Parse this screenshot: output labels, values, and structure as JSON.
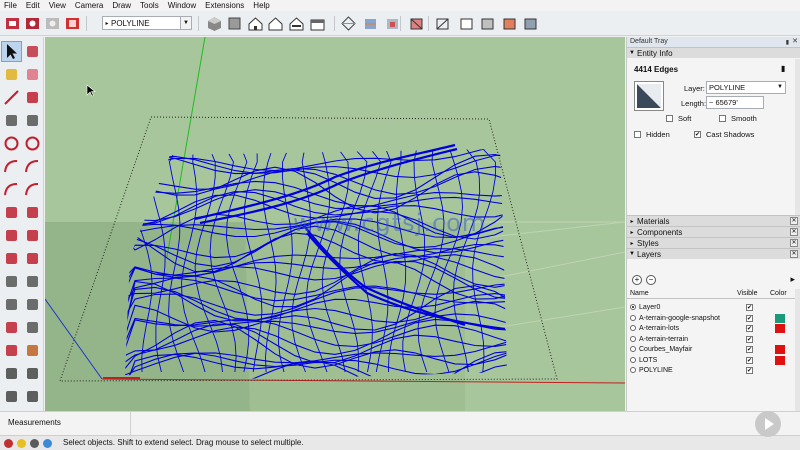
{
  "menu": [
    "File",
    "Edit",
    "View",
    "Camera",
    "Draw",
    "Tools",
    "Window",
    "Extensions",
    "Help"
  ],
  "toolbar": {
    "layer_select_value": "POLYLINE",
    "icons": [
      "get-models-icon",
      "share-model-icon",
      "share-component-icon",
      "extension-warehouse-icon",
      "iso-view-icon",
      "top-view-icon",
      "front-view-icon",
      "right-view-icon",
      "back-view-icon",
      "left-view-icon",
      "section-plane-icon",
      "display-section-icon",
      "section-cuts-icon",
      "xray-icon",
      "wireframe-icon",
      "hidden-line-icon",
      "shaded-icon",
      "shaded-textures-icon",
      "monochrome-icon"
    ]
  },
  "left_tools": [
    "select-tool-icon",
    "component-tool-icon",
    "paint-bucket-icon",
    "eraser-icon",
    "line-tool-icon",
    "freehand-tool-icon",
    "rectangle-tool-icon",
    "rotated-rectangle-icon",
    "circle-tool-icon",
    "polygon-tool-icon",
    "arc-tool-icon",
    "two-point-arc-icon",
    "three-point-arc-icon",
    "pie-tool-icon",
    "move-tool-icon",
    "push-pull-icon",
    "rotate-tool-icon",
    "follow-me-icon",
    "scale-tool-icon",
    "offset-tool-icon",
    "tape-measure-icon",
    "dimension-tool-icon",
    "protractor-icon",
    "text-tool-icon",
    "axes-tool-icon",
    "3d-text-icon",
    "orbit-tool-icon",
    "pan-tool-icon",
    "zoom-tool-icon",
    "zoom-window-icon",
    "zoom-extents-icon",
    "previous-view-icon"
  ],
  "viewport": {
    "watermark": "www.cgtsj.com",
    "colors": {
      "ground": "#a8c69b",
      "lines": "#0000dd"
    }
  },
  "tray": {
    "title": "Default Tray",
    "entity_info": {
      "header": "Entity Info",
      "title": "4414 Edges",
      "layer_label": "Layer:",
      "layer_value": "POLYLINE",
      "length_label": "Length:",
      "length_value": "~ 65679'",
      "soft_label": "Soft",
      "smooth_label": "Smooth",
      "hidden_label": "Hidden",
      "cast_shadows_label": "Cast Shadows",
      "check_mark": "✔"
    },
    "panels": [
      "Materials",
      "Components",
      "Styles",
      "Layers"
    ],
    "layers": {
      "columns": {
        "name": "Name",
        "visible": "Visible",
        "color": "Color"
      },
      "rows": [
        {
          "name": "Layer0",
          "active": true,
          "color": ""
        },
        {
          "name": "A-terrain-google-snapshot",
          "active": false,
          "color": "#1a9a7a"
        },
        {
          "name": "A-terrain-lots",
          "active": false,
          "color": "#e01010"
        },
        {
          "name": "A-terrain-terrain",
          "active": false,
          "color": ""
        },
        {
          "name": "Courbes_Mayfair",
          "active": false,
          "color": "#e01010"
        },
        {
          "name": "LOTS",
          "active": false,
          "color": "#e01010"
        },
        {
          "name": "POLYLINE",
          "active": false,
          "color": ""
        }
      ]
    }
  },
  "measurements_label": "Measurements",
  "status_text": "Select objects. Shift to extend select. Drag mouse to select multiple."
}
